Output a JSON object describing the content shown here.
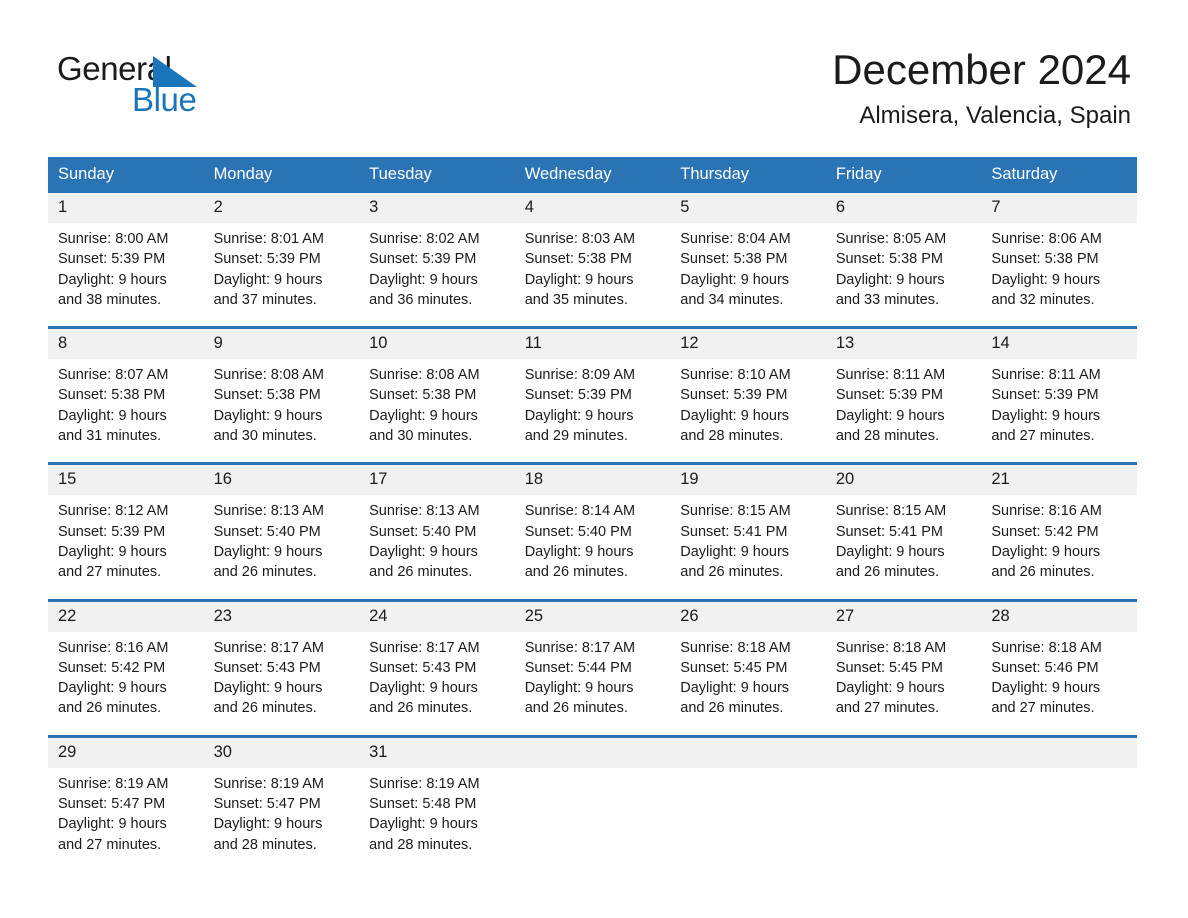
{
  "brand": {
    "name_part1": "General",
    "name_part2": "Blue",
    "accent_color": "#1b75bb",
    "triangle_icon": "brand-triangle-icon"
  },
  "header": {
    "title": "December 2024",
    "subtitle": "Almisera, Valencia, Spain"
  },
  "theme": {
    "header_bar": "#2a74b5",
    "date_band": "#f1f1f1",
    "separator": "#2a74b5",
    "text": "#1b1b1b"
  },
  "weekday_headers": [
    "Sunday",
    "Monday",
    "Tuesday",
    "Wednesday",
    "Thursday",
    "Friday",
    "Saturday"
  ],
  "weeks": [
    {
      "days": [
        {
          "date": "1",
          "sunrise": "Sunrise: 8:00 AM",
          "sunset": "Sunset: 5:39 PM",
          "daylight_line1": "Daylight: 9 hours",
          "daylight_line2": "and 38 minutes."
        },
        {
          "date": "2",
          "sunrise": "Sunrise: 8:01 AM",
          "sunset": "Sunset: 5:39 PM",
          "daylight_line1": "Daylight: 9 hours",
          "daylight_line2": "and 37 minutes."
        },
        {
          "date": "3",
          "sunrise": "Sunrise: 8:02 AM",
          "sunset": "Sunset: 5:39 PM",
          "daylight_line1": "Daylight: 9 hours",
          "daylight_line2": "and 36 minutes."
        },
        {
          "date": "4",
          "sunrise": "Sunrise: 8:03 AM",
          "sunset": "Sunset: 5:38 PM",
          "daylight_line1": "Daylight: 9 hours",
          "daylight_line2": "and 35 minutes."
        },
        {
          "date": "5",
          "sunrise": "Sunrise: 8:04 AM",
          "sunset": "Sunset: 5:38 PM",
          "daylight_line1": "Daylight: 9 hours",
          "daylight_line2": "and 34 minutes."
        },
        {
          "date": "6",
          "sunrise": "Sunrise: 8:05 AM",
          "sunset": "Sunset: 5:38 PM",
          "daylight_line1": "Daylight: 9 hours",
          "daylight_line2": "and 33 minutes."
        },
        {
          "date": "7",
          "sunrise": "Sunrise: 8:06 AM",
          "sunset": "Sunset: 5:38 PM",
          "daylight_line1": "Daylight: 9 hours",
          "daylight_line2": "and 32 minutes."
        }
      ]
    },
    {
      "days": [
        {
          "date": "8",
          "sunrise": "Sunrise: 8:07 AM",
          "sunset": "Sunset: 5:38 PM",
          "daylight_line1": "Daylight: 9 hours",
          "daylight_line2": "and 31 minutes."
        },
        {
          "date": "9",
          "sunrise": "Sunrise: 8:08 AM",
          "sunset": "Sunset: 5:38 PM",
          "daylight_line1": "Daylight: 9 hours",
          "daylight_line2": "and 30 minutes."
        },
        {
          "date": "10",
          "sunrise": "Sunrise: 8:08 AM",
          "sunset": "Sunset: 5:38 PM",
          "daylight_line1": "Daylight: 9 hours",
          "daylight_line2": "and 30 minutes."
        },
        {
          "date": "11",
          "sunrise": "Sunrise: 8:09 AM",
          "sunset": "Sunset: 5:39 PM",
          "daylight_line1": "Daylight: 9 hours",
          "daylight_line2": "and 29 minutes."
        },
        {
          "date": "12",
          "sunrise": "Sunrise: 8:10 AM",
          "sunset": "Sunset: 5:39 PM",
          "daylight_line1": "Daylight: 9 hours",
          "daylight_line2": "and 28 minutes."
        },
        {
          "date": "13",
          "sunrise": "Sunrise: 8:11 AM",
          "sunset": "Sunset: 5:39 PM",
          "daylight_line1": "Daylight: 9 hours",
          "daylight_line2": "and 28 minutes."
        },
        {
          "date": "14",
          "sunrise": "Sunrise: 8:11 AM",
          "sunset": "Sunset: 5:39 PM",
          "daylight_line1": "Daylight: 9 hours",
          "daylight_line2": "and 27 minutes."
        }
      ]
    },
    {
      "days": [
        {
          "date": "15",
          "sunrise": "Sunrise: 8:12 AM",
          "sunset": "Sunset: 5:39 PM",
          "daylight_line1": "Daylight: 9 hours",
          "daylight_line2": "and 27 minutes."
        },
        {
          "date": "16",
          "sunrise": "Sunrise: 8:13 AM",
          "sunset": "Sunset: 5:40 PM",
          "daylight_line1": "Daylight: 9 hours",
          "daylight_line2": "and 26 minutes."
        },
        {
          "date": "17",
          "sunrise": "Sunrise: 8:13 AM",
          "sunset": "Sunset: 5:40 PM",
          "daylight_line1": "Daylight: 9 hours",
          "daylight_line2": "and 26 minutes."
        },
        {
          "date": "18",
          "sunrise": "Sunrise: 8:14 AM",
          "sunset": "Sunset: 5:40 PM",
          "daylight_line1": "Daylight: 9 hours",
          "daylight_line2": "and 26 minutes."
        },
        {
          "date": "19",
          "sunrise": "Sunrise: 8:15 AM",
          "sunset": "Sunset: 5:41 PM",
          "daylight_line1": "Daylight: 9 hours",
          "daylight_line2": "and 26 minutes."
        },
        {
          "date": "20",
          "sunrise": "Sunrise: 8:15 AM",
          "sunset": "Sunset: 5:41 PM",
          "daylight_line1": "Daylight: 9 hours",
          "daylight_line2": "and 26 minutes."
        },
        {
          "date": "21",
          "sunrise": "Sunrise: 8:16 AM",
          "sunset": "Sunset: 5:42 PM",
          "daylight_line1": "Daylight: 9 hours",
          "daylight_line2": "and 26 minutes."
        }
      ]
    },
    {
      "days": [
        {
          "date": "22",
          "sunrise": "Sunrise: 8:16 AM",
          "sunset": "Sunset: 5:42 PM",
          "daylight_line1": "Daylight: 9 hours",
          "daylight_line2": "and 26 minutes."
        },
        {
          "date": "23",
          "sunrise": "Sunrise: 8:17 AM",
          "sunset": "Sunset: 5:43 PM",
          "daylight_line1": "Daylight: 9 hours",
          "daylight_line2": "and 26 minutes."
        },
        {
          "date": "24",
          "sunrise": "Sunrise: 8:17 AM",
          "sunset": "Sunset: 5:43 PM",
          "daylight_line1": "Daylight: 9 hours",
          "daylight_line2": "and 26 minutes."
        },
        {
          "date": "25",
          "sunrise": "Sunrise: 8:17 AM",
          "sunset": "Sunset: 5:44 PM",
          "daylight_line1": "Daylight: 9 hours",
          "daylight_line2": "and 26 minutes."
        },
        {
          "date": "26",
          "sunrise": "Sunrise: 8:18 AM",
          "sunset": "Sunset: 5:45 PM",
          "daylight_line1": "Daylight: 9 hours",
          "daylight_line2": "and 26 minutes."
        },
        {
          "date": "27",
          "sunrise": "Sunrise: 8:18 AM",
          "sunset": "Sunset: 5:45 PM",
          "daylight_line1": "Daylight: 9 hours",
          "daylight_line2": "and 27 minutes."
        },
        {
          "date": "28",
          "sunrise": "Sunrise: 8:18 AM",
          "sunset": "Sunset: 5:46 PM",
          "daylight_line1": "Daylight: 9 hours",
          "daylight_line2": "and 27 minutes."
        }
      ]
    },
    {
      "days": [
        {
          "date": "29",
          "sunrise": "Sunrise: 8:19 AM",
          "sunset": "Sunset: 5:47 PM",
          "daylight_line1": "Daylight: 9 hours",
          "daylight_line2": "and 27 minutes."
        },
        {
          "date": "30",
          "sunrise": "Sunrise: 8:19 AM",
          "sunset": "Sunset: 5:47 PM",
          "daylight_line1": "Daylight: 9 hours",
          "daylight_line2": "and 28 minutes."
        },
        {
          "date": "31",
          "sunrise": "Sunrise: 8:19 AM",
          "sunset": "Sunset: 5:48 PM",
          "daylight_line1": "Daylight: 9 hours",
          "daylight_line2": "and 28 minutes."
        },
        {
          "date": "",
          "sunrise": "",
          "sunset": "",
          "daylight_line1": "",
          "daylight_line2": ""
        },
        {
          "date": "",
          "sunrise": "",
          "sunset": "",
          "daylight_line1": "",
          "daylight_line2": ""
        },
        {
          "date": "",
          "sunrise": "",
          "sunset": "",
          "daylight_line1": "",
          "daylight_line2": ""
        },
        {
          "date": "",
          "sunrise": "",
          "sunset": "",
          "daylight_line1": "",
          "daylight_line2": ""
        }
      ]
    }
  ]
}
